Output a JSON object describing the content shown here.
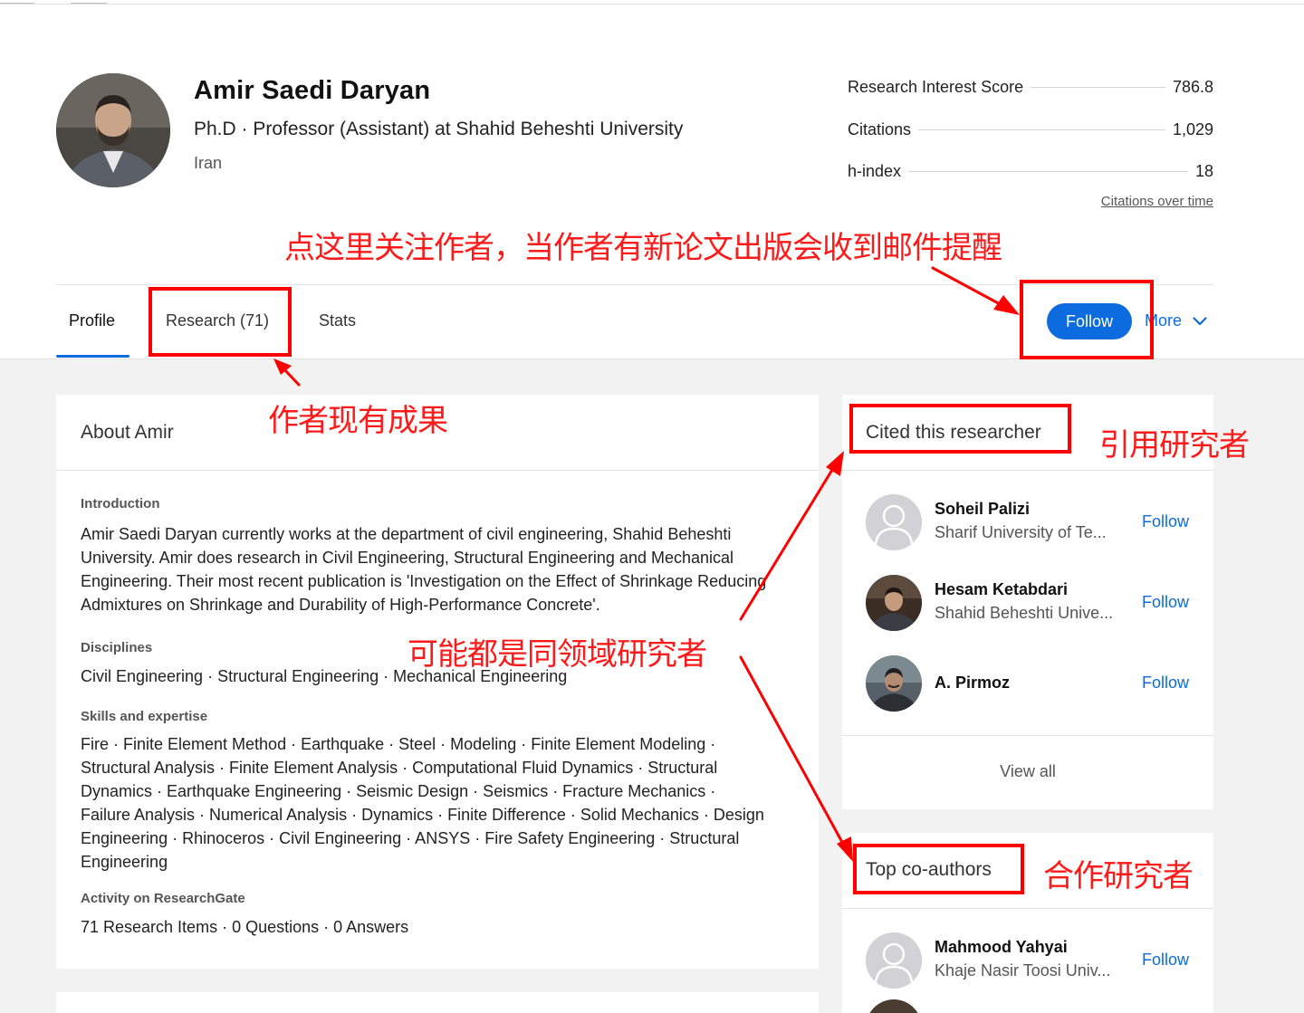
{
  "profile": {
    "name": "Amir Saedi Daryan",
    "position": "Ph.D · Professor (Assistant) at Shahid Beheshti University",
    "country": "Iran"
  },
  "stats": [
    {
      "label": "Research Interest Score",
      "value": "786.8"
    },
    {
      "label": "Citations",
      "value": "1,029"
    },
    {
      "label": "h-index",
      "value": "18"
    }
  ],
  "citations_link": "Citations over time",
  "tabs": [
    {
      "label": "Profile",
      "active": true
    },
    {
      "label": "Research (71)"
    },
    {
      "label": "Stats"
    }
  ],
  "actions": {
    "follow": "Follow",
    "more": "More"
  },
  "about": {
    "title": "About Amir",
    "intro_label": "Introduction",
    "intro_text": "Amir Saedi Daryan currently works at the department of civil engineering, Shahid Beheshti University. Amir does research in Civil Engineering, Structural Engineering and Mechanical Engineering. Their most recent publication is 'Investigation on the Effect of Shrinkage Reducing Admixtures on Shrinkage and Durability of High-Performance Concrete'.",
    "disciplines_label": "Disciplines",
    "disciplines_text": "Civil Engineering · Structural Engineering · Mechanical Engineering",
    "skills_label": "Skills and expertise",
    "skills_text": "Fire · Finite Element Method · Earthquake · Steel · Modeling · Finite Element Modeling · Structural Analysis · Finite Element Analysis · Computational Fluid Dynamics · Structural Dynamics · Earthquake Engineering · Seismic Design · Seismics · Fracture Mechanics · Failure Analysis · Numerical Analysis · Dynamics · Finite Difference · Solid Mechanics · Design Engineering · Rhinoceros · Civil Engineering · ANSYS · Fire Safety Engineering · Structural Engineering",
    "activity_label": "Activity on ResearchGate",
    "activity_text": "71 Research Items · 0 Questions · 0 Answers"
  },
  "cited": {
    "title": "Cited this researcher",
    "people": [
      {
        "name": "Soheil Palizi",
        "institution": "Sharif University of Te...",
        "follow": "Follow"
      },
      {
        "name": "Hesam Ketabdari",
        "institution": "Shahid Beheshti Unive...",
        "follow": "Follow"
      },
      {
        "name": "A. Pirmoz",
        "institution": "",
        "follow": "Follow"
      }
    ],
    "view_all": "View all"
  },
  "coauthors": {
    "title": "Top co-authors",
    "people": [
      {
        "name": "Mahmood Yahyai",
        "institution": "Khaje Nasir Toosi Univ...",
        "follow": "Follow"
      }
    ]
  },
  "annotations": {
    "follow_note": "点这里关注作者，当作者有新论文出版会收到邮件提醒",
    "research_note": "作者现有成果",
    "cited_note": "引用研究者",
    "field_note": "可能都是同领域研究者",
    "coauthor_note": "合作研究者"
  },
  "colors": {
    "accent": "#0c6cdf",
    "annotation": "#ff0000",
    "background": "#f2f2f2"
  }
}
